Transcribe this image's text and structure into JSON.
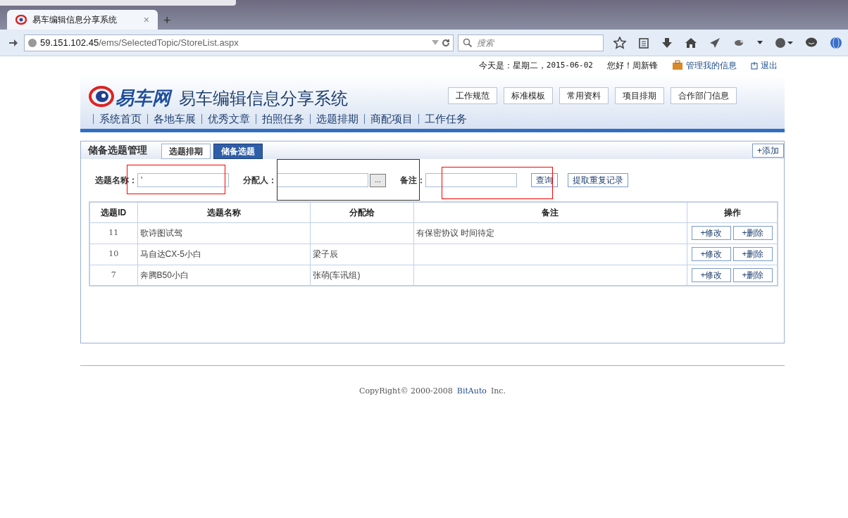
{
  "browser": {
    "tab": {
      "title": "易车编辑信息分享系统",
      "close": "×",
      "new_tab": "+"
    },
    "address": {
      "host": "59.151.102.45",
      "path": "/ems/SelectedTopic/StoreList.aspx"
    },
    "search": {
      "placeholder": "搜索"
    }
  },
  "topbar": {
    "date_label": "今天是：星期二，",
    "date": "2015-06-02",
    "greeting": "您好！周新锋",
    "manage": "管理我的信息",
    "logout": "退出"
  },
  "header": {
    "logo": "易车网",
    "title": "易车编辑信息分享系统",
    "buttons": [
      "工作规范",
      "标准模板",
      "常用资料",
      "项目排期",
      "合作部门信息"
    ],
    "nav": [
      "系统首页",
      "各地车展",
      "优秀文章",
      "拍照任务",
      "选题排期",
      "商配项目",
      "工作任务"
    ]
  },
  "panel": {
    "title": "储备选题管理",
    "tabs": [
      {
        "label": "选题排期",
        "selected": false
      },
      {
        "label": "储备选题",
        "selected": true
      }
    ],
    "add": "+添加",
    "filters": {
      "name_label": "选题名称：",
      "name_value": "'",
      "assignee_label": "分配人：",
      "picker": "...",
      "note_label": "备注：",
      "query": "查询",
      "duplicates": "提取重复记录"
    },
    "table": {
      "columns": [
        "选题ID",
        "选题名称",
        "分配给",
        "备注",
        "操作"
      ],
      "rows": [
        {
          "id": "11",
          "name": "歌诗图试驾",
          "assignee": "",
          "note": "有保密协议 时间待定",
          "edit": "+修改",
          "delete": "+删除"
        },
        {
          "id": "10",
          "name": "马自达CX-5小白",
          "assignee": "梁子辰",
          "note": "",
          "edit": "+修改",
          "delete": "+删除"
        },
        {
          "id": "7",
          "name": "奔腾B50小白",
          "assignee": "张萌(车讯组)",
          "note": "",
          "edit": "+修改",
          "delete": "+删除"
        }
      ]
    }
  },
  "annotations": [
    {
      "color": "#ff0000"
    },
    {
      "color": "#333333"
    },
    {
      "color": "#ff0000"
    }
  ],
  "footer": {
    "copyright": "CopyRight© 2000-2008",
    "company": "BitAuto",
    "suffix": "Inc."
  }
}
